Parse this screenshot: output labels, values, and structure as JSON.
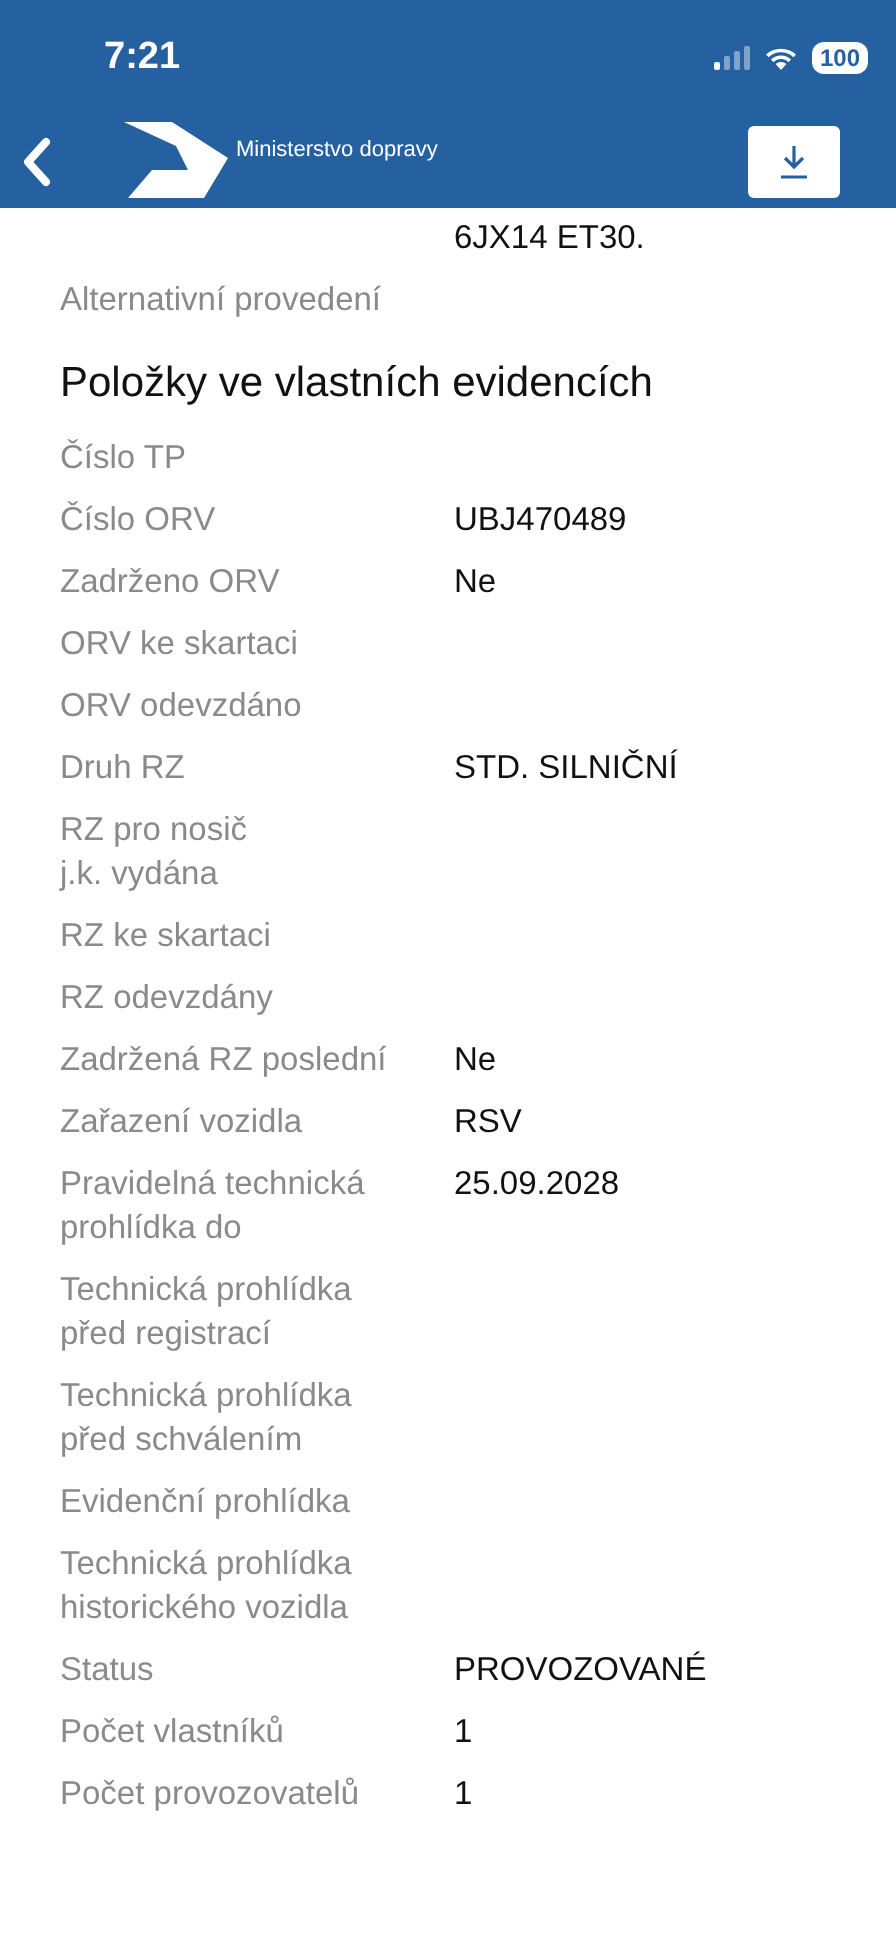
{
  "status_bar": {
    "time": "7:21",
    "battery": "100"
  },
  "header": {
    "title": "Ministerstvo dopravy"
  },
  "sections": [
    {
      "rows": [
        {
          "value": "6JX14 ET30."
        },
        {
          "label": "Alternativní provedení"
        }
      ]
    },
    {
      "title": "Položky ve vlastních evidencích",
      "rows": [
        {
          "label": "Číslo TP"
        },
        {
          "label": "Číslo ORV",
          "value": "UBJ470489"
        },
        {
          "label": "Zadrženo ORV",
          "value": "Ne"
        },
        {
          "label": "ORV ke skartaci"
        },
        {
          "label": "ORV odevzdáno"
        },
        {
          "label": "Druh RZ",
          "value": "STD. SILNIČNÍ"
        },
        {
          "label": "RZ pro nosič\nj.k. vydána"
        },
        {
          "label": "RZ ke skartaci"
        },
        {
          "label": "RZ odevzdány"
        },
        {
          "label": "Zadržená RZ poslední",
          "value": "Ne"
        },
        {
          "label": "Zařazení vozidla",
          "value": "RSV"
        },
        {
          "label": "Pravidelná technická\nprohlídka do",
          "value": "25.09.2028"
        },
        {
          "label": "Technická prohlídka\npřed registrací"
        },
        {
          "label": "Technická prohlídka\npřed schválením"
        },
        {
          "label": "Evidenční prohlídka"
        },
        {
          "label": "Technická prohlídka\nhistorického vozidla"
        },
        {
          "label": "Status",
          "value": "PROVOZOVANÉ"
        },
        {
          "label": "Počet vlastníků",
          "value": "1"
        },
        {
          "label": "Počet provozovatelů",
          "value": "1"
        }
      ]
    }
  ]
}
